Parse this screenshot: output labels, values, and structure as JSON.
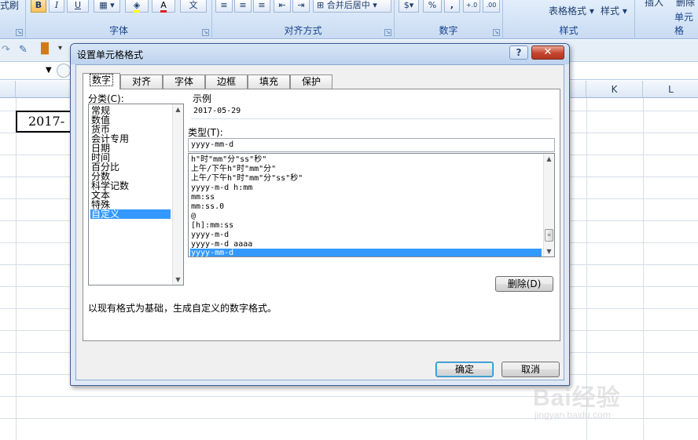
{
  "ribbon": {
    "top_left_fragment": "式刷",
    "bold": "B",
    "italic": "I",
    "underline": "U",
    "font_color_glyph": "A",
    "wen_glyph": "文",
    "merge_center": "合并后居中",
    "percent": "%",
    "comma": ",",
    "dec_inc": ".00→.0",
    "table_format": "表格格式",
    "style": "样式",
    "insert_fragment": "插入",
    "delete_fragment": "删除",
    "groups": {
      "font": "字体",
      "alignment": "对齐方式",
      "number": "数字",
      "styles": "样式",
      "cells": "单元格"
    }
  },
  "sheet": {
    "columns": [
      "K",
      "L"
    ],
    "date_cell": "2017-"
  },
  "dialog": {
    "title": "设置单元格格式",
    "help": "?",
    "close": "✕",
    "tabs": [
      "数字",
      "对齐",
      "字体",
      "边框",
      "填充",
      "保护"
    ],
    "category_label": "分类(C):",
    "categories": [
      "常规",
      "数值",
      "货币",
      "会计专用",
      "日期",
      "时间",
      "百分比",
      "分数",
      "科学记数",
      "文本",
      "特殊",
      "自定义"
    ],
    "selected_category": "自定义",
    "sample_label": "示例",
    "sample_value": "2017-05-29",
    "type_label": "类型(T):",
    "type_value": "yyyy-mm-d",
    "formats": [
      "h\"时\"mm\"分\"ss\"秒\"",
      "上午/下午h\"时\"mm\"分\"",
      "上午/下午h\"时\"mm\"分\"ss\"秒\"",
      "yyyy-m-d h:mm",
      "mm:ss",
      "mm:ss.0",
      "@",
      "[h]:mm:ss",
      "yyyy-m-d",
      "yyyy-m-d aaaa",
      "yyyy-mm-d"
    ],
    "selected_format": "yyyy-mm-d",
    "delete_button": "删除(D)",
    "description": "以现有格式为基础，生成自定义的数字格式。",
    "ok_button": "确定",
    "cancel_button": "取消"
  },
  "watermark": {
    "brand": "Bai经验",
    "url": "jingyan.baidu.com"
  }
}
